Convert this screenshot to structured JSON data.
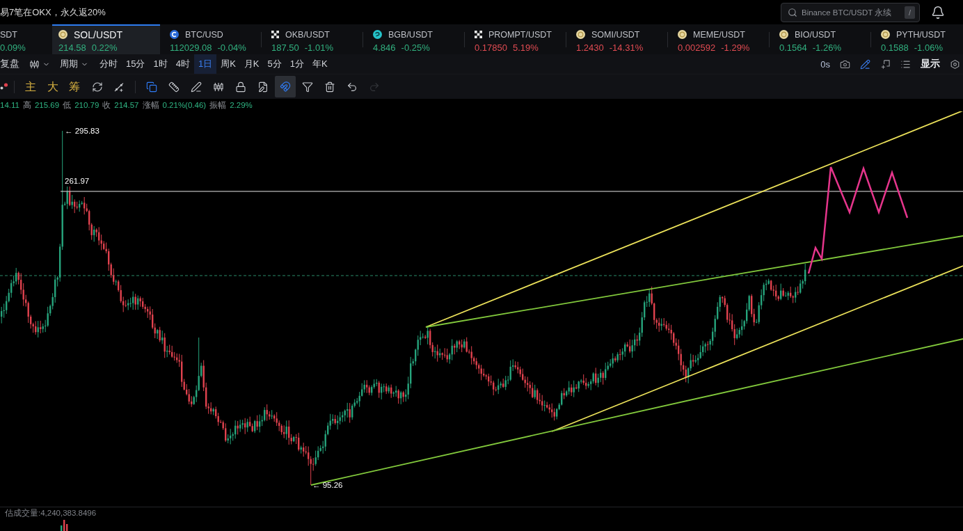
{
  "promo": "易7笔在OKX，永久返20%",
  "search": {
    "placeholder": "Binance BTC/USDT 永续",
    "shortcut": "/"
  },
  "tickers": [
    {
      "kind": "none",
      "name": "SDT",
      "change": "0.09%",
      "color": "#31b07f",
      "selected": false
    },
    {
      "kind": "coin",
      "name": "SOL/USDT",
      "price": "214.58",
      "change": "0.22%",
      "color": "#31b07f",
      "selected": true
    },
    {
      "kind": "ring",
      "name": "BTC/USD",
      "price": "112029.08",
      "change": "-0.04%",
      "color": "#31b07f",
      "selected": false
    },
    {
      "kind": "cross",
      "name": "OKB/USDT",
      "price": "187.50",
      "change": "-1.01%",
      "color": "#31b07f",
      "selected": false
    },
    {
      "kind": "swirl",
      "name": "BGB/USDT",
      "price": "4.846",
      "change": "-0.25%",
      "color": "#31b07f",
      "selected": false
    },
    {
      "kind": "cross",
      "name": "PROMPT/USDT",
      "price": "0.17850",
      "change": "5.19%",
      "color": "#e04b52",
      "selected": false
    },
    {
      "kind": "coin",
      "name": "SOMI/USDT",
      "price": "1.2430",
      "change": "-14.31%",
      "color": "#e04b52",
      "selected": false
    },
    {
      "kind": "coin",
      "name": "MEME/USDT",
      "price": "0.002592",
      "change": "-1.29%",
      "color": "#e04b52",
      "selected": false
    },
    {
      "kind": "coin",
      "name": "BIO/USDT",
      "price": "0.1564",
      "change": "-1.26%",
      "color": "#31b07f",
      "selected": false
    },
    {
      "kind": "coin",
      "name": "PYTH/USDT",
      "price": "0.1588",
      "change": "-1.06%",
      "color": "#31b07f",
      "selected": false
    }
  ],
  "toolbar": {
    "replay": "复盘",
    "period": "周期",
    "intervals": [
      {
        "label": "分时",
        "selected": false
      },
      {
        "label": "15分",
        "selected": false
      },
      {
        "label": "1时",
        "selected": false
      },
      {
        "label": "4时",
        "selected": false
      },
      {
        "label": "1日",
        "selected": true
      },
      {
        "label": "周K",
        "selected": false
      },
      {
        "label": "月K",
        "selected": false
      },
      {
        "label": "5分",
        "selected": false
      },
      {
        "label": "1分",
        "selected": false
      },
      {
        "label": "年K",
        "selected": false
      }
    ],
    "countdown": "0s",
    "actions": [
      {
        "on": false
      },
      {
        "on": true
      },
      {
        "on": false
      },
      {
        "on": false
      }
    ],
    "display": "显示"
  },
  "drawing_bar": {
    "indicators": [
      {
        "label": "主"
      },
      {
        "label": "大"
      },
      {
        "label": "筹"
      }
    ],
    "tools": [
      {
        "on": true,
        "selected": false,
        "disabled": false
      },
      {
        "on": false,
        "selected": false,
        "disabled": false
      },
      {
        "on": false,
        "selected": false,
        "disabled": false
      },
      {
        "on": false,
        "selected": false,
        "disabled": false
      },
      {
        "on": false,
        "selected": false,
        "disabled": false
      },
      {
        "on": false,
        "selected": false,
        "disabled": false
      },
      {
        "on": true,
        "selected": true,
        "disabled": false
      },
      {
        "on": false,
        "selected": false,
        "disabled": false
      },
      {
        "on": false,
        "selected": false,
        "disabled": false
      },
      {
        "on": false,
        "selected": false,
        "disabled": false
      },
      {
        "on": false,
        "selected": false,
        "disabled": true
      }
    ]
  },
  "quote": [
    {
      "value": "14.11"
    },
    {
      "label": "高",
      "value": "215.69"
    },
    {
      "label": "低",
      "value": "210.79"
    },
    {
      "label": "收",
      "value": "214.57"
    },
    {
      "label": "涨幅",
      "value": "0.21%(0.46)"
    },
    {
      "label": "振幅",
      "value": "2.29%"
    }
  ],
  "chart": {
    "labels": [
      "← 295.83",
      "261.97",
      "← 95.26"
    ]
  },
  "volume": {
    "label": "估成交量:4,240,383.8496"
  }
}
